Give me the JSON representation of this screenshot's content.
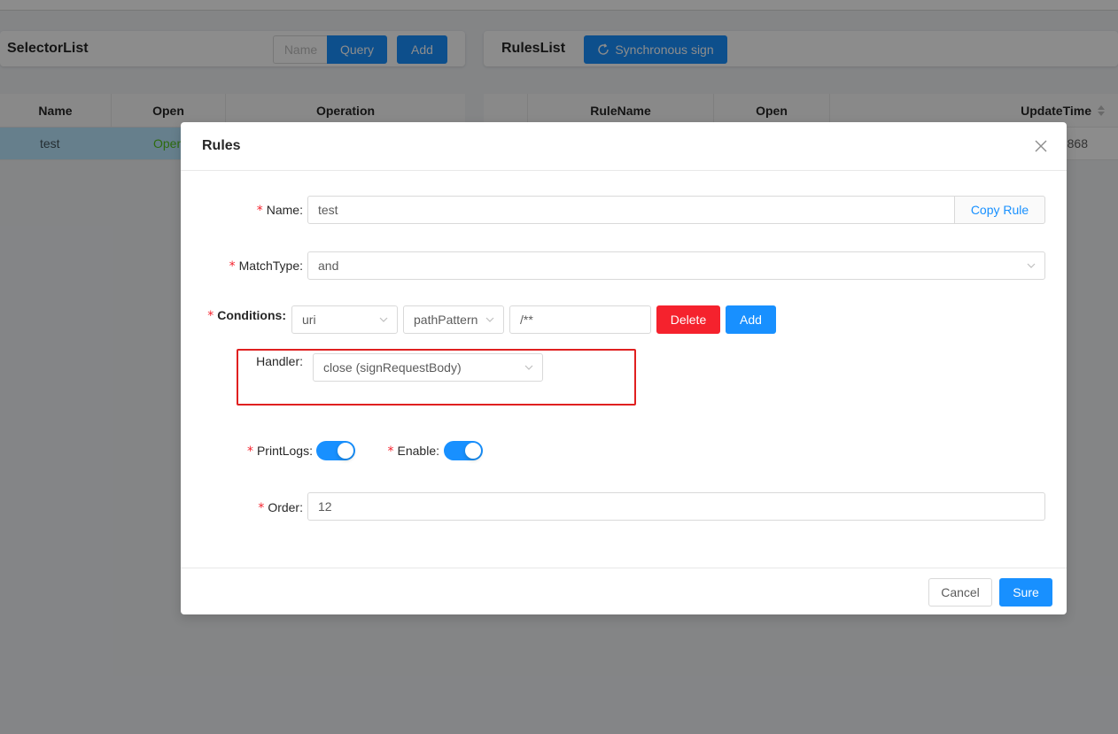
{
  "selector_panel": {
    "title": "SelectorList",
    "search_placeholder": "Name",
    "query_label": "Query",
    "add_label": "Add",
    "columns": [
      "Name",
      "Open",
      "Operation"
    ],
    "row": {
      "name": "test",
      "open": "Open"
    }
  },
  "rules_panel": {
    "title": "RulesList",
    "sync_label": "Synchronous sign",
    "columns": [
      "",
      "RuleName",
      "Open",
      "UpdateTime"
    ],
    "row_partial_time": "868"
  },
  "modal": {
    "title": "Rules",
    "name": {
      "label": "Name",
      "value": "test",
      "copy_label": "Copy Rule"
    },
    "match_type": {
      "label": "MatchType",
      "value": "and"
    },
    "conditions": {
      "label": "Conditions",
      "param_type": "uri",
      "operator": "pathPattern",
      "value": "/**",
      "delete_label": "Delete",
      "add_label": "Add"
    },
    "handler": {
      "label": "Handler",
      "value": "close (signRequestBody)"
    },
    "print_logs": {
      "label": "PrintLogs",
      "on": true
    },
    "enable": {
      "label": "Enable",
      "on": true
    },
    "order": {
      "label": "Order",
      "value": "12"
    },
    "cancel_label": "Cancel",
    "sure_label": "Sure"
  },
  "colors": {
    "primary": "#1890ff",
    "danger": "#f5222d",
    "highlight_box": "#e02020"
  },
  "icons": [
    "sync-icon",
    "close-icon",
    "chevron-down-icon",
    "sort-icon"
  ]
}
